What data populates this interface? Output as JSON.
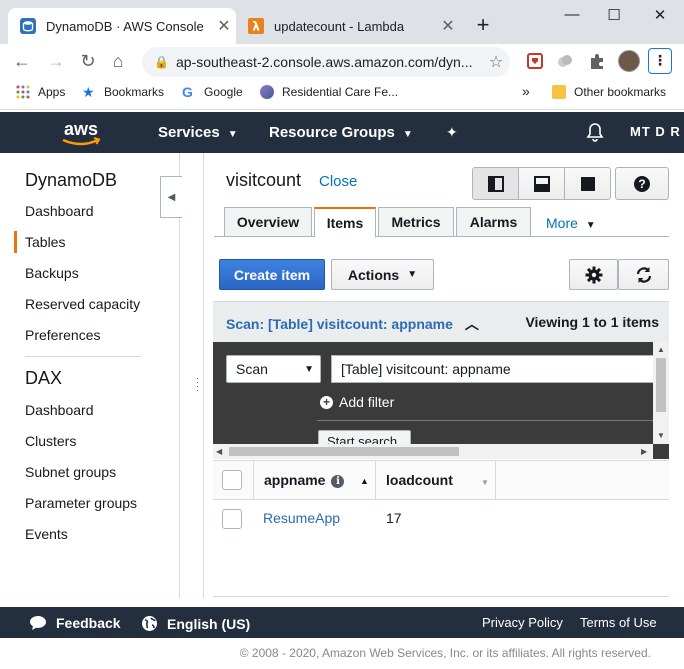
{
  "browser": {
    "tabs": [
      {
        "title": "DynamoDB · AWS Console",
        "active": true
      },
      {
        "title": "updatecount - Lambda",
        "active": false
      }
    ],
    "new_tab": "+",
    "url": "ap-southeast-2.console.aws.amazon.com/dyn...",
    "bookmarks": [
      "Apps",
      "Bookmarks",
      "Google",
      "Residential Care Fe...",
      "Other bookmarks"
    ],
    "bookmarks_overflow": "»"
  },
  "aws": {
    "logo": "aws",
    "services": "Services",
    "resource_groups": "Resource Groups",
    "account": "MT D R C"
  },
  "sidebar": {
    "title": "DynamoDB",
    "items": [
      "Dashboard",
      "Tables",
      "Backups",
      "Reserved capacity",
      "Preferences"
    ],
    "active_item": "Tables",
    "dax_title": "DAX",
    "dax_items": [
      "Dashboard",
      "Clusters",
      "Subnet groups",
      "Parameter groups",
      "Events"
    ]
  },
  "main": {
    "table_name": "visitcount",
    "close_label": "Close",
    "tabs": [
      "Overview",
      "Items",
      "Metrics",
      "Alarms"
    ],
    "active_tab": "Items",
    "more_label": "More",
    "create_item": "Create item",
    "actions": "Actions",
    "scan_title": "Scan: [Table] visitcount: appname",
    "viewing": "Viewing 1 to 1 items",
    "scan_mode": "Scan",
    "scan_target": "[Table] visitcount: appname",
    "add_filter": "Add filter",
    "start_search": "Start search",
    "columns": [
      "appname",
      "loadcount"
    ],
    "rows": [
      {
        "appname": "ResumeApp",
        "loadcount": "17"
      }
    ]
  },
  "footer": {
    "feedback": "Feedback",
    "language": "English (US)",
    "privacy": "Privacy Policy",
    "terms": "Terms of Use",
    "copyright": "© 2008 - 2020, Amazon Web Services, Inc. or its affiliates. All rights reserved."
  },
  "colors": {
    "aws_nav": "#232f3e",
    "aws_orange": "#ec7211",
    "link_blue": "#0073bb",
    "primary_button": "#2b66c4",
    "scan_panel": "#3b3b3b"
  }
}
